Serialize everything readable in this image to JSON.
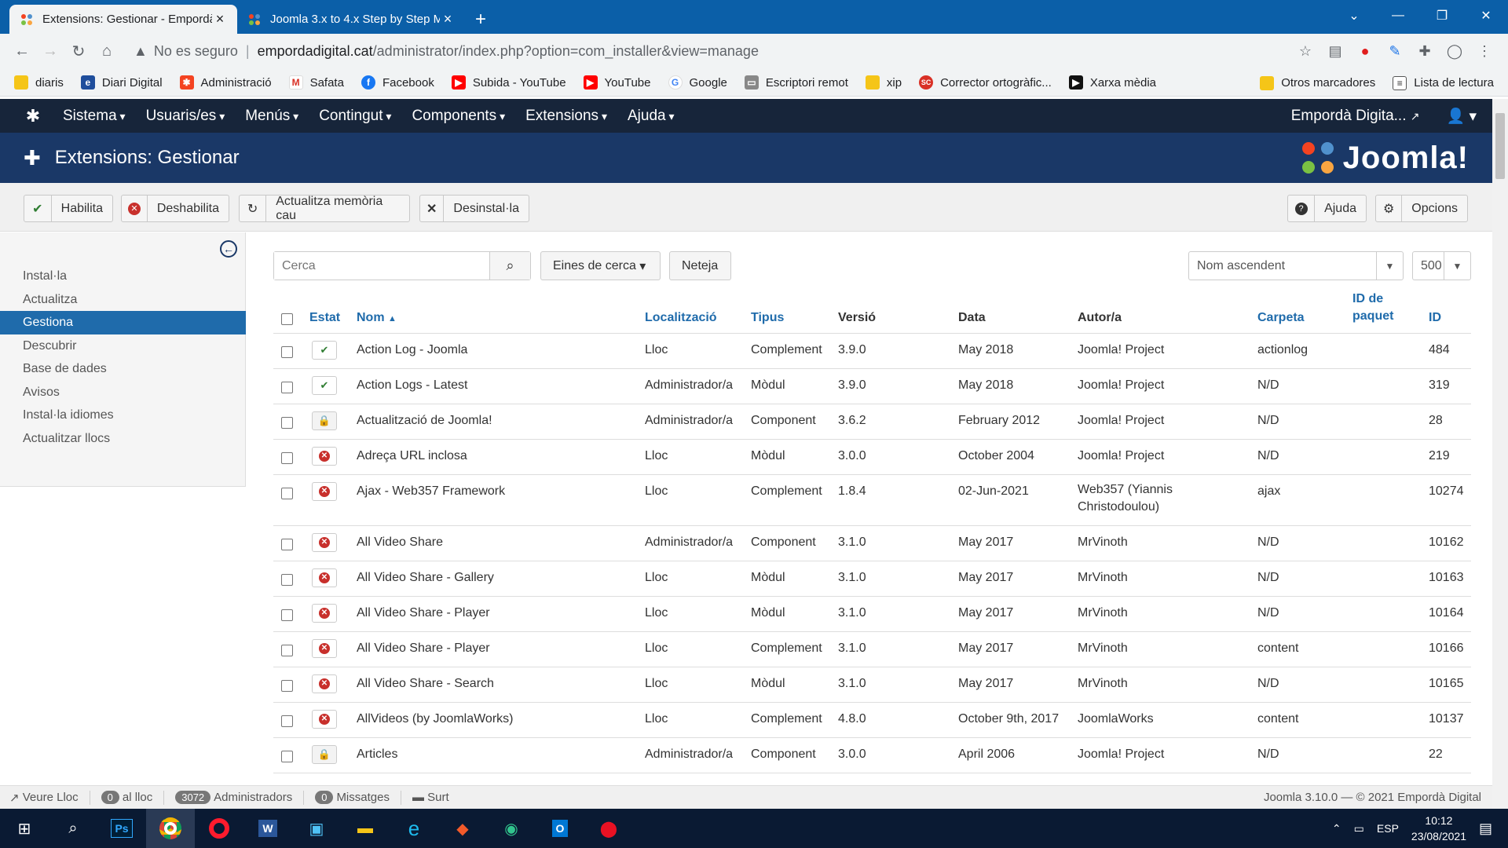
{
  "browser": {
    "tabs": [
      {
        "title": "Extensions: Gestionar - Empordà",
        "active": true
      },
      {
        "title": "Joomla 3.x to 4.x Step by Step M",
        "active": false
      }
    ],
    "url": {
      "warning": "No es seguro",
      "host": "empordadigital.cat",
      "path": "/administrator/index.php?option=com_installer&view=manage"
    },
    "bookmarks": [
      "diaris",
      "Diari Digital",
      "Administració",
      "Safata",
      "Facebook",
      "Subida - YouTube",
      "YouTube",
      "Google",
      "Escriptori remot",
      "xip",
      "Corrector ortogràfic...",
      "Xarxa mèdia"
    ],
    "bookmarks_right": [
      "Otros marcadores",
      "Lista de lectura"
    ]
  },
  "joomla": {
    "menu": [
      "Sistema",
      "Usuaris/es",
      "Menús",
      "Contingut",
      "Components",
      "Extensions",
      "Ajuda"
    ],
    "site_name": "Empordà Digita...",
    "page_title": "Extensions: Gestionar",
    "logo_text": "Joomla!",
    "toolbar": {
      "enable": "Habilita",
      "disable": "Deshabilita",
      "refresh_cache": "Actualitza memòria cau",
      "uninstall": "Desinstal·la",
      "help": "Ajuda",
      "options": "Opcions"
    },
    "sidebar": [
      "Instal·la",
      "Actualitza",
      "Gestiona",
      "Descubrir",
      "Base de dades",
      "Avisos",
      "Instal·la idiomes",
      "Actualitzar llocs"
    ],
    "filters": {
      "search_placeholder": "Cerca",
      "search_tools": "Eines de cerca",
      "clear": "Neteja",
      "sort": "Nom ascendent",
      "limit": "500"
    },
    "columns": {
      "status": "Estat",
      "name": "Nom",
      "location": "Localització",
      "type": "Tipus",
      "version": "Versió",
      "date": "Data",
      "author": "Autor/a",
      "folder": "Carpeta",
      "package_id_1": "ID de",
      "package_id_2": "paquet",
      "id": "ID"
    },
    "rows": [
      {
        "status": "enabled",
        "name": "Action Log - Joomla",
        "location": "Lloc",
        "type": "Complement",
        "version": "3.9.0",
        "date": "May 2018",
        "author": "Joomla! Project",
        "author2": "",
        "folder": "actionlog",
        "id": "484"
      },
      {
        "status": "enabled",
        "name": "Action Logs - Latest",
        "location": "Administrador/a",
        "type": "Mòdul",
        "version": "3.9.0",
        "date": "May 2018",
        "author": "Joomla! Project",
        "author2": "",
        "folder": "N/D",
        "id": "319"
      },
      {
        "status": "locked",
        "name": "Actualització de Joomla!",
        "location": "Administrador/a",
        "type": "Component",
        "version": "3.6.2",
        "date": "February 2012",
        "author": "Joomla! Project",
        "author2": "",
        "folder": "N/D",
        "id": "28"
      },
      {
        "status": "disabled",
        "name": "Adreça URL inclosa",
        "location": "Lloc",
        "type": "Mòdul",
        "version": "3.0.0",
        "date": "October 2004",
        "author": "Joomla! Project",
        "author2": "",
        "folder": "N/D",
        "id": "219"
      },
      {
        "status": "disabled",
        "name": "Ajax - Web357 Framework",
        "location": "Lloc",
        "type": "Complement",
        "version": "1.8.4",
        "date": "02-Jun-2021",
        "author": "Web357 (Yiannis",
        "author2": "Christodoulou)",
        "folder": "ajax",
        "id": "10274"
      },
      {
        "status": "disabled",
        "name": "All Video Share",
        "location": "Administrador/a",
        "type": "Component",
        "version": "3.1.0",
        "date": "May 2017",
        "author": "MrVinoth",
        "author2": "",
        "folder": "N/D",
        "id": "10162"
      },
      {
        "status": "disabled",
        "name": "All Video Share - Gallery",
        "location": "Lloc",
        "type": "Mòdul",
        "version": "3.1.0",
        "date": "May 2017",
        "author": "MrVinoth",
        "author2": "",
        "folder": "N/D",
        "id": "10163"
      },
      {
        "status": "disabled",
        "name": "All Video Share - Player",
        "location": "Lloc",
        "type": "Mòdul",
        "version": "3.1.0",
        "date": "May 2017",
        "author": "MrVinoth",
        "author2": "",
        "folder": "N/D",
        "id": "10164"
      },
      {
        "status": "disabled",
        "name": "All Video Share - Player",
        "location": "Lloc",
        "type": "Complement",
        "version": "3.1.0",
        "date": "May 2017",
        "author": "MrVinoth",
        "author2": "",
        "folder": "content",
        "id": "10166"
      },
      {
        "status": "disabled",
        "name": "All Video Share - Search",
        "location": "Lloc",
        "type": "Mòdul",
        "version": "3.1.0",
        "date": "May 2017",
        "author": "MrVinoth",
        "author2": "",
        "folder": "N/D",
        "id": "10165"
      },
      {
        "status": "disabled",
        "name": "AllVideos (by JoomlaWorks)",
        "location": "Lloc",
        "type": "Complement",
        "version": "4.8.0",
        "date": "October 9th, 2017",
        "author": "JoomlaWorks",
        "author2": "",
        "folder": "content",
        "id": "10137"
      },
      {
        "status": "locked",
        "name": "Articles",
        "location": "Administrador/a",
        "type": "Component",
        "version": "3.0.0",
        "date": "April 2006",
        "author": "Joomla! Project",
        "author2": "",
        "folder": "N/D",
        "id": "22"
      }
    ],
    "footer": {
      "view_site": "Veure Lloc",
      "visitors_count": "0",
      "visitors_label": "al lloc",
      "admins_count": "3072",
      "admins_label": "Administradors",
      "messages_count": "0",
      "messages_label": "Missatges",
      "logout": "Surt",
      "version": "Joomla 3.10.0",
      "copyright": "— © 2021 Empordà Digital"
    }
  },
  "taskbar": {
    "lang": "ESP",
    "time": "10:12",
    "date": "23/08/2021"
  },
  "colors": {
    "tabstrip": "#0b5fa8",
    "nav": "#17253a",
    "header": "#1a3867",
    "accent": "#1f6bab"
  }
}
